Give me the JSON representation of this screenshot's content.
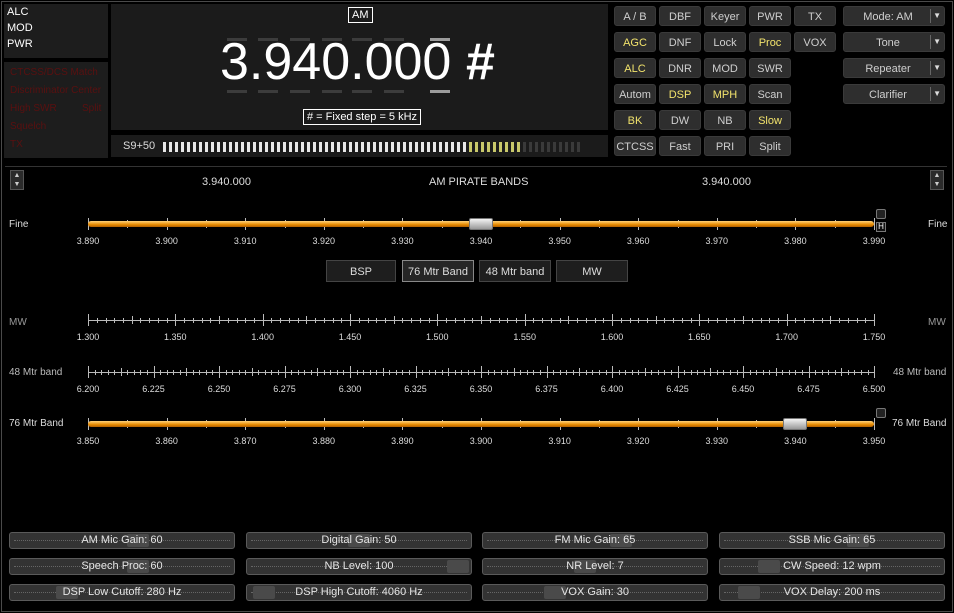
{
  "status_top": [
    "ALC",
    "MOD",
    "PWR"
  ],
  "status_bottom": [
    "CTCSS/DCS Match",
    "Discriminator Center",
    "High SWR",
    "Split",
    "Squelch",
    "TX"
  ],
  "display": {
    "mode": "AM",
    "frequency": "3.940.000",
    "hash": "#",
    "step_note": "# = Fixed step = 5 kHz",
    "smeter_label": "S9+50",
    "smeter_level": 0.86
  },
  "buttons": [
    {
      "label": "A / B",
      "on": false
    },
    {
      "label": "DBF",
      "on": false
    },
    {
      "label": "Keyer",
      "on": false
    },
    {
      "label": "PWR",
      "on": false
    },
    {
      "label": "TX",
      "on": false
    },
    {
      "label": "AGC",
      "on": true
    },
    {
      "label": "DNF",
      "on": false
    },
    {
      "label": "Lock",
      "on": false
    },
    {
      "label": "Proc",
      "on": true
    },
    {
      "label": "VOX",
      "on": false
    },
    {
      "label": "ALC",
      "on": true
    },
    {
      "label": "DNR",
      "on": false
    },
    {
      "label": "MOD",
      "on": false
    },
    {
      "label": "SWR",
      "on": false
    },
    {
      "label": "Autom",
      "on": false
    },
    {
      "label": "DSP",
      "on": true
    },
    {
      "label": "MPH",
      "on": true
    },
    {
      "label": "Scan",
      "on": false
    },
    {
      "label": "BK",
      "on": true
    },
    {
      "label": "DW",
      "on": false
    },
    {
      "label": "NB",
      "on": false
    },
    {
      "label": "Slow",
      "on": true
    },
    {
      "label": "CTCSS",
      "on": false
    },
    {
      "label": "Fast",
      "on": false
    },
    {
      "label": "PRI",
      "on": false
    },
    {
      "label": "Split",
      "on": false
    }
  ],
  "right_dropdowns": [
    "Mode: AM",
    "Tone",
    "Repeater",
    "Clarifier"
  ],
  "band": {
    "left_freq": "3.940.000",
    "title": "AM PIRATE BANDS",
    "right_freq": "3.940.000",
    "fine_label": "Fine",
    "fine_ticks": [
      "3.890",
      "3.900",
      "3.910",
      "3.920",
      "3.930",
      "3.940",
      "3.950",
      "3.960",
      "3.970",
      "3.980",
      "3.990"
    ],
    "fine_value": 0.5,
    "band_buttons": [
      "BSP",
      "76 Mtr Band",
      "48 Mtr band",
      "MW"
    ],
    "selected_band": "76 Mtr Band",
    "mw_label": "MW",
    "mw_ticks": [
      "1.300",
      "1.350",
      "1.400",
      "1.450",
      "1.500",
      "1.550",
      "1.600",
      "1.650",
      "1.700",
      "1.750"
    ],
    "m48_label": "48 Mtr band",
    "m48_ticks": [
      "6.200",
      "6.225",
      "6.250",
      "6.275",
      "6.300",
      "6.325",
      "6.350",
      "6.375",
      "6.400",
      "6.425",
      "6.450",
      "6.475",
      "6.500"
    ],
    "m76_label": "76 Mtr Band",
    "m76_ticks": [
      "3.850",
      "3.860",
      "3.870",
      "3.880",
      "3.890",
      "3.900",
      "3.910",
      "3.920",
      "3.930",
      "3.940",
      "3.950"
    ],
    "m76_value": 0.9,
    "lock_mark": "H"
  },
  "gains": [
    {
      "label": "AM Mic Gain: 60",
      "level": 0.58
    },
    {
      "label": "Digital Gain: 50",
      "level": 0.5
    },
    {
      "label": "FM Mic Gain: 65",
      "level": 0.63
    },
    {
      "label": "SSB Mic Gain: 65",
      "level": 0.63
    },
    {
      "label": "Speech Proc: 60",
      "level": 0.58
    },
    {
      "label": "NB Level: 100",
      "level": 1.0
    },
    {
      "label": "NR Level: 7",
      "level": 0.45
    },
    {
      "label": "CW Speed: 12 wpm",
      "level": 0.18
    },
    {
      "label": "DSP Low Cutoff: 280 Hz",
      "level": 0.22
    },
    {
      "label": "DSP High Cutoff: 4060 Hz",
      "level": 0.02
    },
    {
      "label": "VOX Gain: 30",
      "level": 0.3
    },
    {
      "label": "VOX Delay: 200 ms",
      "level": 0.08
    }
  ]
}
